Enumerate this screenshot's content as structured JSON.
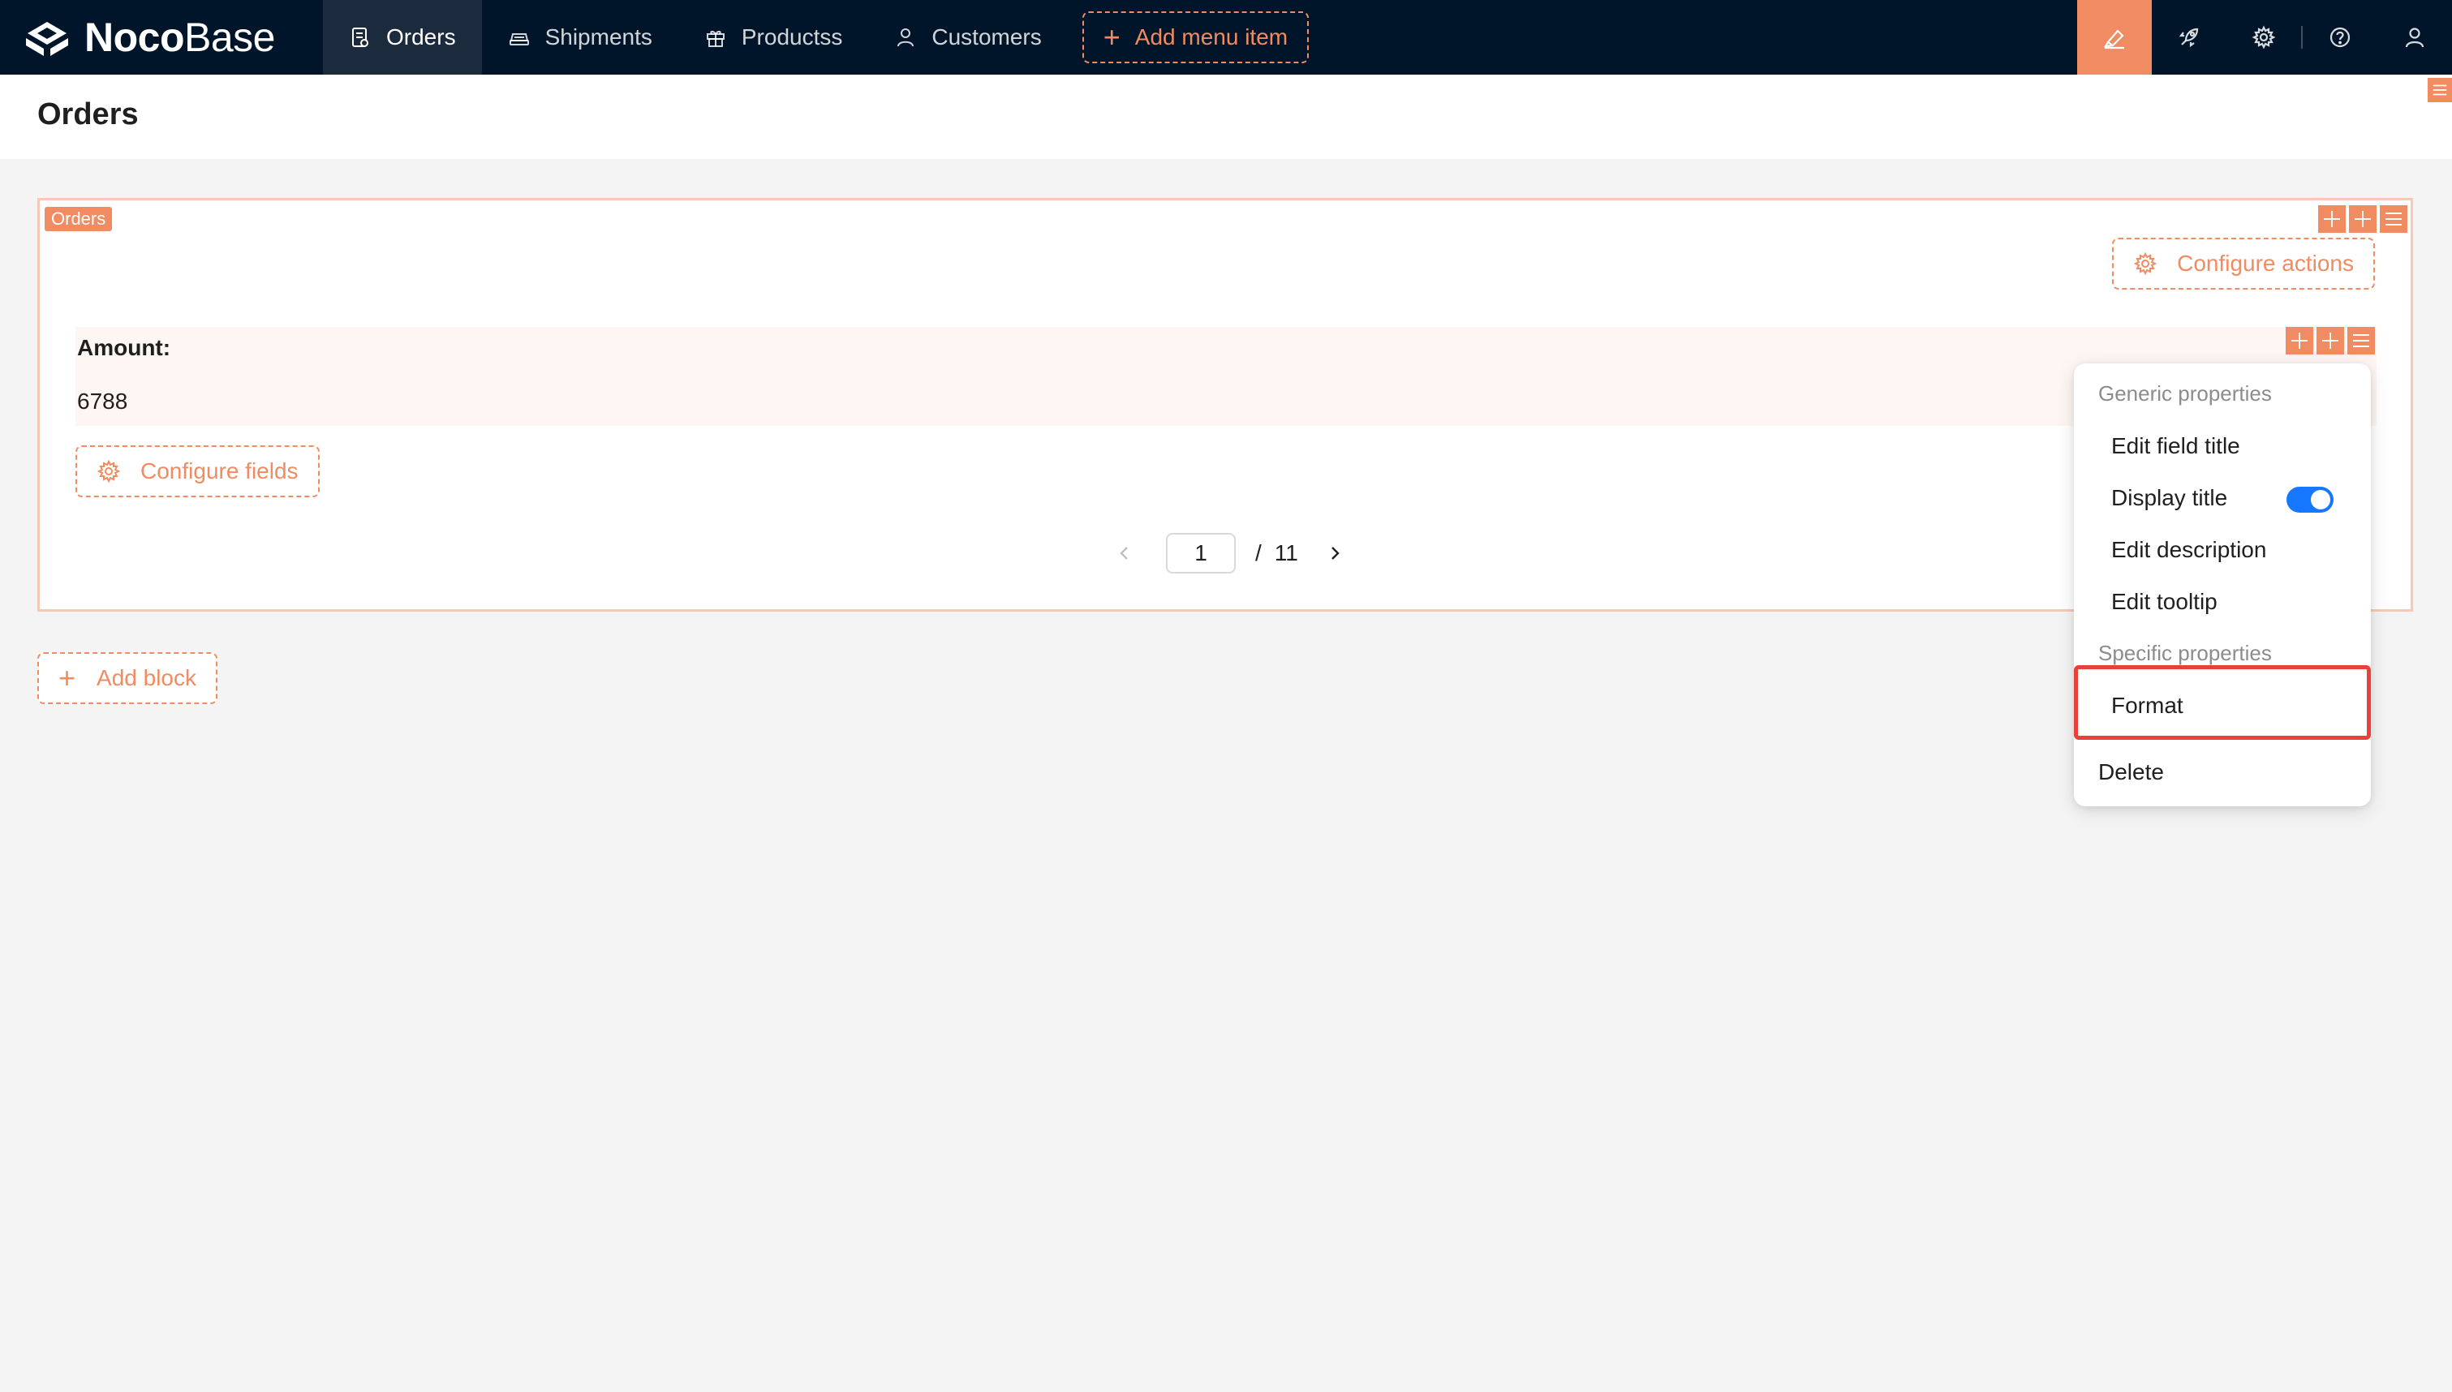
{
  "app": {
    "logo_bold": "Noco",
    "logo_light": "Base"
  },
  "nav": {
    "items": [
      {
        "label": "Orders",
        "icon": "file-icon",
        "active": true
      },
      {
        "label": "Shipments",
        "icon": "car-icon",
        "active": false
      },
      {
        "label": "Productss",
        "icon": "gift-icon",
        "active": false
      },
      {
        "label": "Customers",
        "icon": "user-icon",
        "active": false
      }
    ],
    "add_menu_label": "Add menu item"
  },
  "page": {
    "title": "Orders"
  },
  "block": {
    "tag": "Orders",
    "configure_actions_label": "Configure actions",
    "field": {
      "label": "Amount",
      "colon": ":",
      "value": "6788"
    },
    "configure_fields_label": "Configure fields",
    "pagination": {
      "current": "1",
      "separator": "/",
      "total": "11"
    }
  },
  "add_block_label": "Add block",
  "dropdown": {
    "generic_heading": "Generic properties",
    "edit_field_title": "Edit field title",
    "display_title": "Display title",
    "display_title_on": true,
    "edit_description": "Edit description",
    "edit_tooltip": "Edit tooltip",
    "specific_heading": "Specific properties",
    "format": "Format",
    "delete": "Delete"
  },
  "colors": {
    "accent": "#f18b62",
    "nav_bg": "#001529",
    "toggle": "#1677ff",
    "highlight": "#e8403a"
  }
}
